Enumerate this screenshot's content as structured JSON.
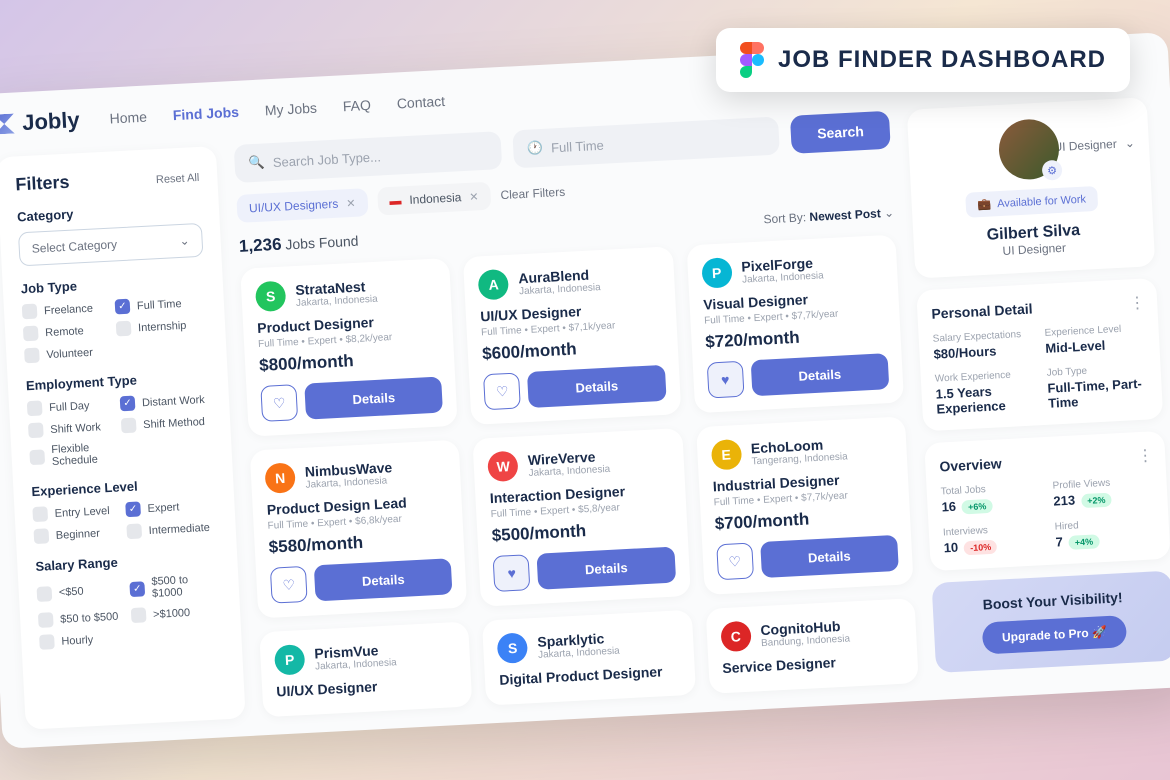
{
  "banner": {
    "title": "JOB FINDER DASHBOARD"
  },
  "brand": "Jobly",
  "nav": [
    "Home",
    "Find Jobs",
    "My Jobs",
    "FAQ",
    "Contact"
  ],
  "nav_active": 1,
  "user_role": "UI Designer",
  "filters": {
    "title": "Filters",
    "reset": "Reset All",
    "category_label": "Category",
    "category_placeholder": "Select Category",
    "jobtype": {
      "label": "Job Type",
      "items": [
        {
          "label": "Freelance",
          "on": false
        },
        {
          "label": "Full Time",
          "on": true
        },
        {
          "label": "Remote",
          "on": false
        },
        {
          "label": "Internship",
          "on": false
        },
        {
          "label": "Volunteer",
          "on": false
        }
      ]
    },
    "employment": {
      "label": "Employment Type",
      "items": [
        {
          "label": "Full Day",
          "on": false
        },
        {
          "label": "Distant Work",
          "on": true
        },
        {
          "label": "Shift Work",
          "on": false
        },
        {
          "label": "Shift Method",
          "on": false
        },
        {
          "label": "Flexible Schedule",
          "on": false
        }
      ]
    },
    "experience": {
      "label": "Experience Level",
      "items": [
        {
          "label": "Entry Level",
          "on": false
        },
        {
          "label": "Expert",
          "on": true
        },
        {
          "label": "Beginner",
          "on": false
        },
        {
          "label": "Intermediate",
          "on": false
        }
      ]
    },
    "salary": {
      "label": "Salary Range",
      "items": [
        {
          "label": "<$50",
          "on": false
        },
        {
          "label": "$500 to $1000",
          "on": true
        },
        {
          "label": "$50 to $500",
          "on": false
        },
        {
          "label": ">$1000",
          "on": false
        },
        {
          "label": "Hourly",
          "on": false
        }
      ]
    }
  },
  "search": {
    "placeholder": "Search Job Type...",
    "time": "Full Time",
    "button": "Search"
  },
  "tags": {
    "tag1": "UI/UX Designers",
    "tag2": "Indonesia",
    "clear": "Clear Filters"
  },
  "results": {
    "count": "1,236",
    "suffix": "Jobs Found",
    "sort_label": "Sort By:",
    "sort_value": "Newest Post"
  },
  "jobs": [
    {
      "company": "StrataNest",
      "loc": "Jakarta, Indonesia",
      "title": "Product Designer",
      "meta": "Full Time • Expert • $8,2k/year",
      "salary": "$800/month",
      "color": "#22c55e",
      "fav": false
    },
    {
      "company": "AuraBlend",
      "loc": "Jakarta, Indonesia",
      "title": "UI/UX Designer",
      "meta": "Full Time • Expert • $7,1k/year",
      "salary": "$600/month",
      "color": "#10b981",
      "fav": false
    },
    {
      "company": "PixelForge",
      "loc": "Jakarta, Indonesia",
      "title": "Visual Designer",
      "meta": "Full Time • Expert • $7,7k/year",
      "salary": "$720/month",
      "color": "#06b6d4",
      "fav": true
    },
    {
      "company": "NimbusWave",
      "loc": "Jakarta, Indonesia",
      "title": "Product Design Lead",
      "meta": "Full Time • Expert • $6,8k/year",
      "salary": "$580/month",
      "color": "#f97316",
      "fav": false
    },
    {
      "company": "WireVerve",
      "loc": "Jakarta, Indonesia",
      "title": "Interaction Designer",
      "meta": "Full Time • Expert • $5,8/year",
      "salary": "$500/month",
      "color": "#ef4444",
      "fav": true
    },
    {
      "company": "EchoLoom",
      "loc": "Tangerang, Indonesia",
      "title": "Industrial Designer",
      "meta": "Full Time • Expert • $7,7k/year",
      "salary": "$700/month",
      "color": "#eab308",
      "fav": false
    },
    {
      "company": "PrismVue",
      "loc": "Jakarta, Indonesia",
      "title": "UI/UX Designer",
      "meta": "",
      "salary": "",
      "color": "#14b8a6",
      "fav": false,
      "mini": true
    },
    {
      "company": "Sparklytic",
      "loc": "Jakarta, Indonesia",
      "title": "Digital Product Designer",
      "meta": "",
      "salary": "",
      "color": "#3b82f6",
      "fav": false,
      "mini": true
    },
    {
      "company": "CognitoHub",
      "loc": "Bandung, Indonesia",
      "title": "Service Designer",
      "meta": "",
      "salary": "",
      "color": "#dc2626",
      "fav": false,
      "mini": true
    }
  ],
  "details_label": "Details",
  "profile": {
    "available": "Available for Work",
    "name": "Gilbert Silva",
    "role": "UI Designer",
    "personal": {
      "title": "Personal Detail",
      "salary_l": "Salary Expectations",
      "salary_v": "$80/Hours",
      "exp_l": "Experience Level",
      "exp_v": "Mid-Level",
      "we_l": "Work Experience",
      "we_v": "1.5 Years Experience",
      "jt_l": "Job Type",
      "jt_v": "Full-Time, Part-Time"
    },
    "overview": {
      "title": "Overview",
      "tj_l": "Total Jobs",
      "tj_v": "16",
      "tj_d": "+6%",
      "pv_l": "Profile Views",
      "pv_v": "213",
      "pv_d": "+2%",
      "iv_l": "Interviews",
      "iv_v": "10",
      "iv_d": "-10%",
      "hr_l": "Hired",
      "hr_v": "7",
      "hr_d": "+4%"
    },
    "boost": {
      "title": "Boost Your Visibility!",
      "button": "Upgrade to Pro"
    }
  }
}
